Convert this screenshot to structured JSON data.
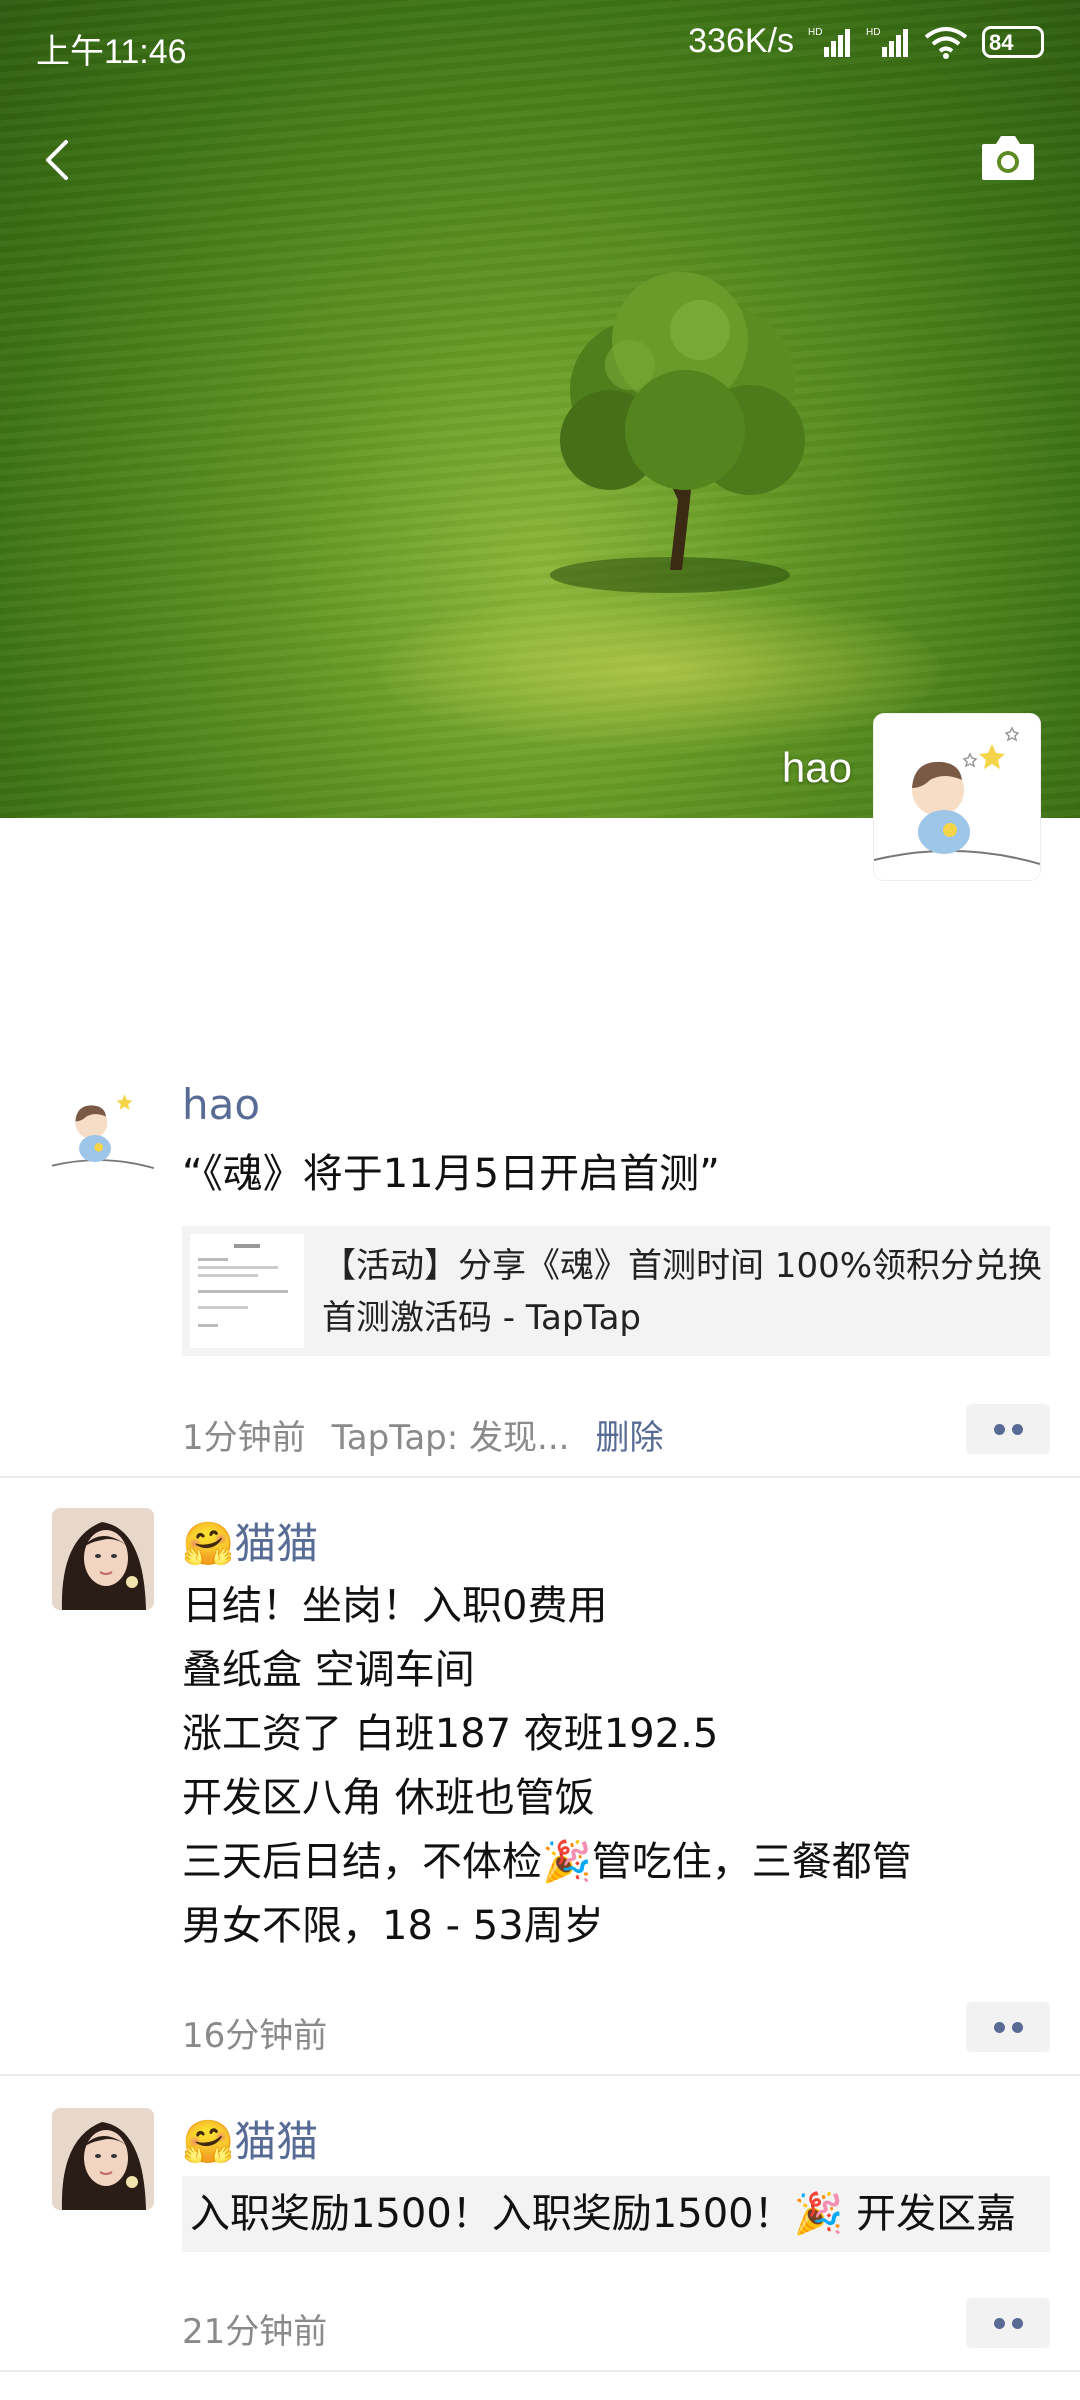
{
  "status_bar": {
    "time": "上午11:46",
    "net_speed": "336K/s",
    "signal1": "HD",
    "signal2": "HD",
    "battery": "84"
  },
  "cover": {
    "username": "hao"
  },
  "posts": [
    {
      "name": "hao",
      "text": "“《魂》将于11月5日开启首测”",
      "link_title": "【活动】分享《魂》首测时间 100%领积分兑换首测激活码 - TapTap",
      "time": "1分钟前",
      "source": "TapTap: 发现...",
      "delete_label": "删除"
    },
    {
      "name_emoji": "🤗",
      "name": "猫猫",
      "lines": [
        "日结！坐岗！入职0费用",
        "叠纸盒 空调车间",
        "涨工资了 白班187 夜班192.5",
        "开发区八角 休班也管饭",
        "三天后日结，不体检🎉管吃住，三餐都管",
        "男女不限，18 - 53周岁"
      ],
      "time": "16分钟前"
    },
    {
      "name_emoji": "🤗",
      "name": "猫猫",
      "text": "入职奖励1500！入职奖励1500！🎉 开发区嘉",
      "time": "21分钟前"
    }
  ],
  "colors": {
    "link_blue": "#576b95",
    "meta_gray": "#8a8a8a"
  }
}
